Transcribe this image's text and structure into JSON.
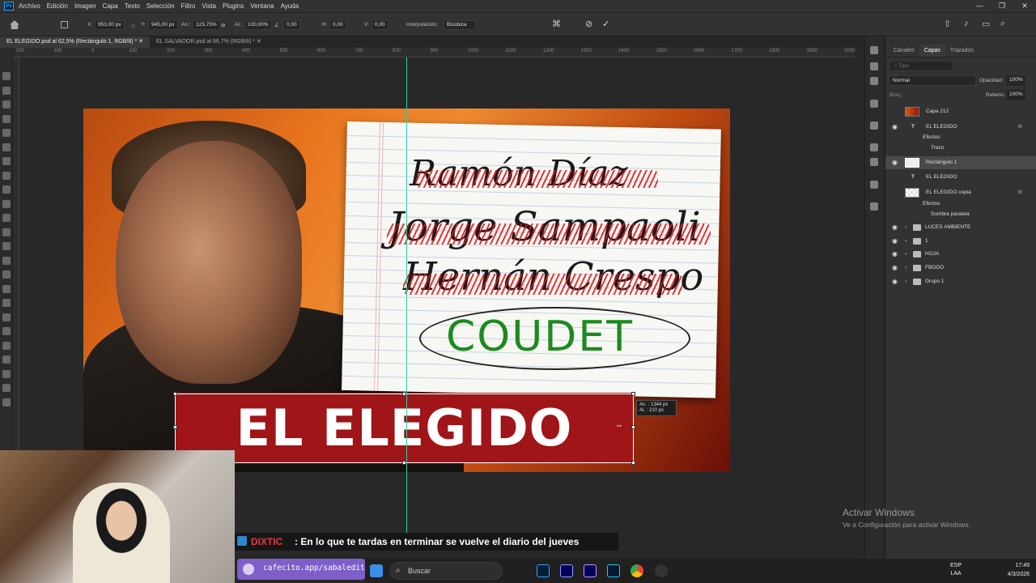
{
  "menu": [
    "Archivo",
    "Edición",
    "Imagen",
    "Capa",
    "Texto",
    "Selección",
    "Filtro",
    "Vista",
    "Plugins",
    "Ventana",
    "Ayuda"
  ],
  "options": {
    "x_label": "X:",
    "x_value": "953,00 px",
    "y_label": "Y:",
    "y_value": "945,00 px",
    "w_label": "An.:",
    "w_value": "123,75%",
    "h_label": "Al.:",
    "h_value": "100,00%",
    "angle_value": "0,00",
    "hskew_label": "H:",
    "hskew_value": "0,00",
    "vskew_label": "V:",
    "vskew_value": "0,00",
    "interp_label": "Interpolación:",
    "interp_value": "Bicúbica"
  },
  "tabs": [
    "EL ELEGIDO.psd al 62,5% (Rectángulo 1, RGB/8) *",
    "EL SALVADOR.psd al 66,7% (RGB/8) *"
  ],
  "ruler_ticks": [
    "200",
    "100",
    "0",
    "100",
    "200",
    "300",
    "400",
    "500",
    "600",
    "700",
    "800",
    "900",
    "1000",
    "1100",
    "1200",
    "1300",
    "1400",
    "1500",
    "1600",
    "1700",
    "1800",
    "1900",
    "2000"
  ],
  "canvas": {
    "names": [
      "Ramón Díaz",
      "Jorge Sampaoli",
      "Hernán Crespo"
    ],
    "chosen": "COUDET",
    "banner": "EL ELEGIDO"
  },
  "size_info": {
    "w": "An. :  1344 px",
    "h": "Al. :    210 px"
  },
  "panel": {
    "tabs": [
      "Canales",
      "Capas",
      "Trazados"
    ],
    "search_placeholder": "Tipo",
    "blend_mode": "Normal",
    "opacity_label": "Opacidad:",
    "opacity_value": "100%",
    "fill_label": "Relleno:",
    "fill_value": "100%",
    "lock_label": "Bloq.:",
    "layers": [
      {
        "name": "Capa 212"
      },
      {
        "name": "EL ELEGIDO"
      },
      {
        "name": "Efectos"
      },
      {
        "name": "Trazo"
      },
      {
        "name": "Rectángulo 1"
      },
      {
        "name": "EL ELEGIDO"
      },
      {
        "name": "EL ELEGIDO copia"
      },
      {
        "name": "Efectos"
      },
      {
        "name": "Sombra paralela"
      },
      {
        "name": "LUCES AMBIENTE"
      },
      {
        "name": "1"
      },
      {
        "name": "HOJA"
      },
      {
        "name": "FBODO"
      },
      {
        "name": "Grupo 1"
      }
    ]
  },
  "watermark": {
    "title": "Activar Windows",
    "subtitle": "Ve a Configuración para activar Windows."
  },
  "chat": {
    "user": "DIXTIC",
    "message": ": En lo que te tardas en terminar se vuelve el diario del jueves"
  },
  "cafecito": "cafecito.app/sabaledita",
  "taskbar": {
    "search": "Buscar",
    "lang1": "ESP",
    "lang2": "LAA",
    "time": "17:49",
    "date": "4/3/2026"
  },
  "window_controls": [
    "—",
    "❐",
    "✕"
  ]
}
